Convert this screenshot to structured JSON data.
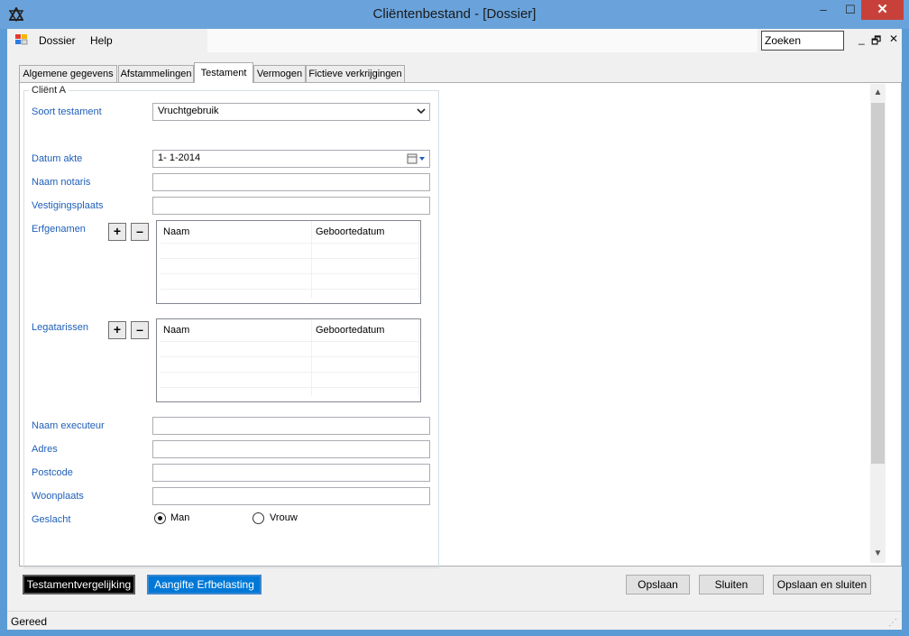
{
  "window": {
    "title": "Cliëntenbestand - [Dossier]",
    "minimize": "–",
    "maximize": "☐",
    "close": "✕"
  },
  "menu": {
    "dossier": "Dossier",
    "help": "Help",
    "search_value": "Zoeken",
    "mdi_min": "_",
    "mdi_restore": "🗗",
    "mdi_close": "✕"
  },
  "tabs": [
    {
      "label": "Algemene gegevens"
    },
    {
      "label": "Afstammelingen"
    },
    {
      "label": "Testament"
    },
    {
      "label": "Vermogen"
    },
    {
      "label": "Fictieve verkrijgingen"
    }
  ],
  "group": {
    "title": "Cliënt A"
  },
  "form": {
    "soort_testament_label": "Soort testament",
    "soort_testament_value": "Vruchtgebruik",
    "datum_akte_label": "Datum akte",
    "datum_akte_value": "1-  1-2014",
    "naam_notaris_label": "Naam notaris",
    "vestigingsplaats_label": "Vestigingsplaats",
    "erfgenamen_label": "Erfgenamen",
    "legatarissen_label": "Legatarissen",
    "naam_executeur_label": "Naam executeur",
    "adres_label": "Adres",
    "postcode_label": "Postcode",
    "woonplaats_label": "Woonplaats",
    "geslacht_label": "Geslacht",
    "geslacht_man": "Man",
    "geslacht_vrouw": "Vrouw",
    "geslacht_selected": "Man"
  },
  "grid_columns": {
    "naam": "Naam",
    "geboortedatum": "Geboortedatum"
  },
  "buttons": {
    "add": "+",
    "remove": "–",
    "testamentvergelijking": "Testamentvergelijking",
    "aangifte_erfbelasting": "Aangifte Erfbelasting",
    "opslaan": "Opslaan",
    "sluiten": "Sluiten",
    "opslaan_en_sluiten": "Opslaan en sluiten"
  },
  "status": {
    "text": "Gereed"
  },
  "colors": {
    "label_blue": "#1e5fb8",
    "titlebar": "#6aa3db",
    "accent_button": "#0078d7"
  },
  "icons": {
    "app": "app-logo-icon",
    "mdi": "document-icon",
    "calendar": "calendar-icon",
    "dropdown": "chevron-down-icon"
  }
}
